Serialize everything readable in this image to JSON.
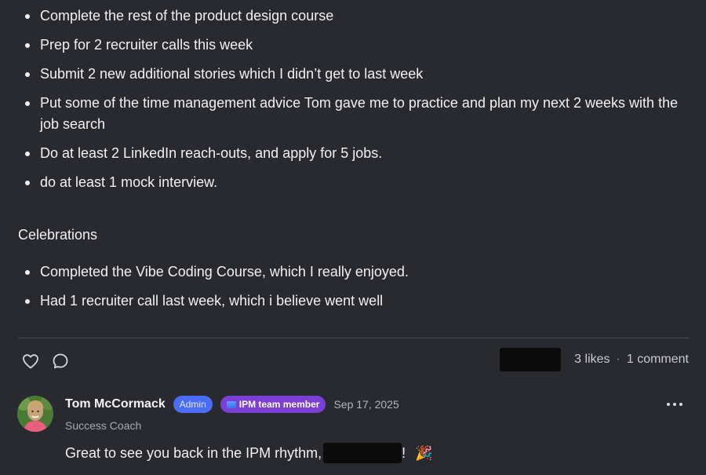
{
  "goals": [
    "Complete the rest of the product design course",
    "Prep for 2 recruiter calls this week",
    "Submit 2 new additional stories which I didn’t get to last week",
    "Put some of the time management advice Tom gave me to practice and plan my next 2 weeks with the job search",
    "Do at least 2 LinkedIn reach-outs, and apply for 5 jobs.",
    "do at least 1 mock interview."
  ],
  "celebrations_heading": "Celebrations",
  "celebrations": [
    "Completed the Vibe Coding Course, which I really enjoyed.",
    "Had 1 recruiter call last week, which i believe went well"
  ],
  "actions": {
    "like_icon": "heart-icon",
    "comment_icon": "speech-bubble-icon"
  },
  "stats": {
    "likes": "3 likes",
    "separator": "·",
    "comments": "1 comment"
  },
  "comment": {
    "author": "Tom McCormack",
    "badge_admin": "Admin",
    "badge_team": "IPM team member",
    "date": "Sep 17, 2025",
    "role": "Success Coach",
    "text": "Great to see you back in the IPM rhythm,",
    "trailing": "!",
    "emoji": "🎉",
    "more_icon": "more-horizontal-icon"
  },
  "colors": {
    "background": "#292a2f",
    "admin_badge": "#4a6cf7",
    "team_badge": "#7b3fd6",
    "divider": "#4a4b52"
  }
}
